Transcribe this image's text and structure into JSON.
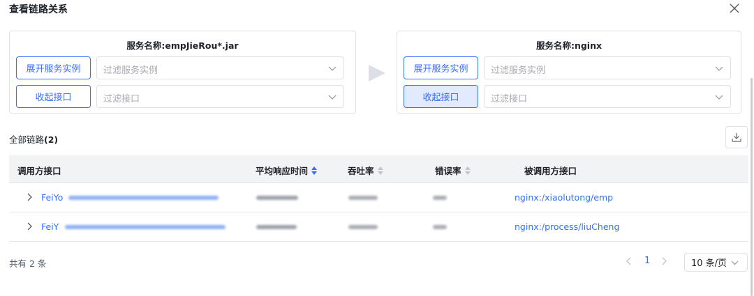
{
  "dialog": {
    "title": "查看链路关系",
    "close_icon": "close-icon"
  },
  "left_service": {
    "name": "服务名称:empJieRou*.jar",
    "expand_button": "展开服务实例",
    "instance_filter_placeholder": "过滤服务实例",
    "collapse_button": "收起接口",
    "interface_filter_placeholder": "过滤接口"
  },
  "right_service": {
    "name": "服务名称:nginx",
    "expand_button": "展开服务实例",
    "instance_filter_placeholder": "过滤服务实例",
    "collapse_button": "收起接口",
    "interface_filter_placeholder": "过滤接口"
  },
  "links": {
    "label": "全部链路",
    "count": "(2)"
  },
  "table": {
    "columns": [
      "调用方接口",
      "平均响应时间",
      "吞吐率",
      "错误率",
      "被调用方接口"
    ],
    "rows": [
      {
        "caller": "FeiYo",
        "callee": "nginx:/xiaolutong/emp"
      },
      {
        "caller": "FeiY",
        "callee": "nginx:/process/liuCheng"
      }
    ]
  },
  "footer": {
    "total": "共有 2 条",
    "current_page": "1",
    "page_size": "10 条/页"
  },
  "colors": {
    "accent": "#3370ff",
    "border": "#dee0e3",
    "header_bg": "#f2f3f5"
  }
}
